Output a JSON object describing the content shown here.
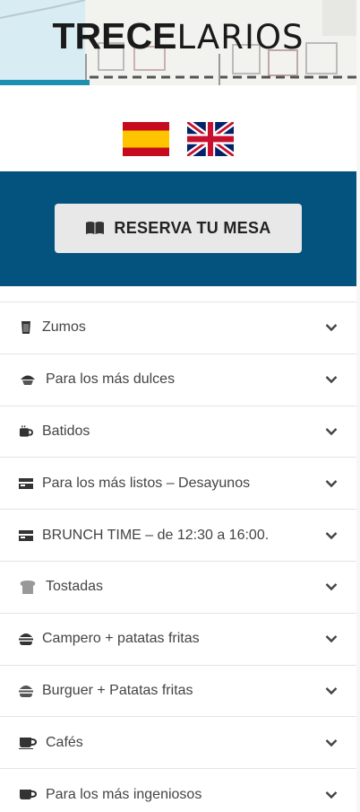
{
  "header": {
    "logo_bold": "TRECE",
    "logo_light": "LARIOS"
  },
  "languages": [
    {
      "name": "spanish-flag-icon"
    },
    {
      "name": "uk-flag-icon"
    }
  ],
  "reserve": {
    "label": "RESERVA TU MESA",
    "icon": "book-icon"
  },
  "menu": {
    "items": [
      {
        "label": "Zumos",
        "icon": "glass-icon"
      },
      {
        "label": "Para los más dulces",
        "icon": "cupcake-icon"
      },
      {
        "label": "Batidos",
        "icon": "mug-icon"
      },
      {
        "label": "Para los más listos – Desayunos",
        "icon": "tray-icon"
      },
      {
        "label": "BRUNCH TIME – de 12:30 a 16:00.",
        "icon": "tray-icon"
      },
      {
        "label": "Tostadas",
        "icon": "toast-icon"
      },
      {
        "label": "Campero + patatas fritas",
        "icon": "burger-icon"
      },
      {
        "label": "Burguer + Patatas fritas",
        "icon": "burger-icon"
      },
      {
        "label": "Cafés",
        "icon": "coffee-icon"
      },
      {
        "label": "Para los más ingeniosos",
        "icon": "coffee-icon"
      }
    ]
  },
  "colors": {
    "band": "#04537e",
    "button": "#e8e8e8",
    "text": "#444444"
  }
}
